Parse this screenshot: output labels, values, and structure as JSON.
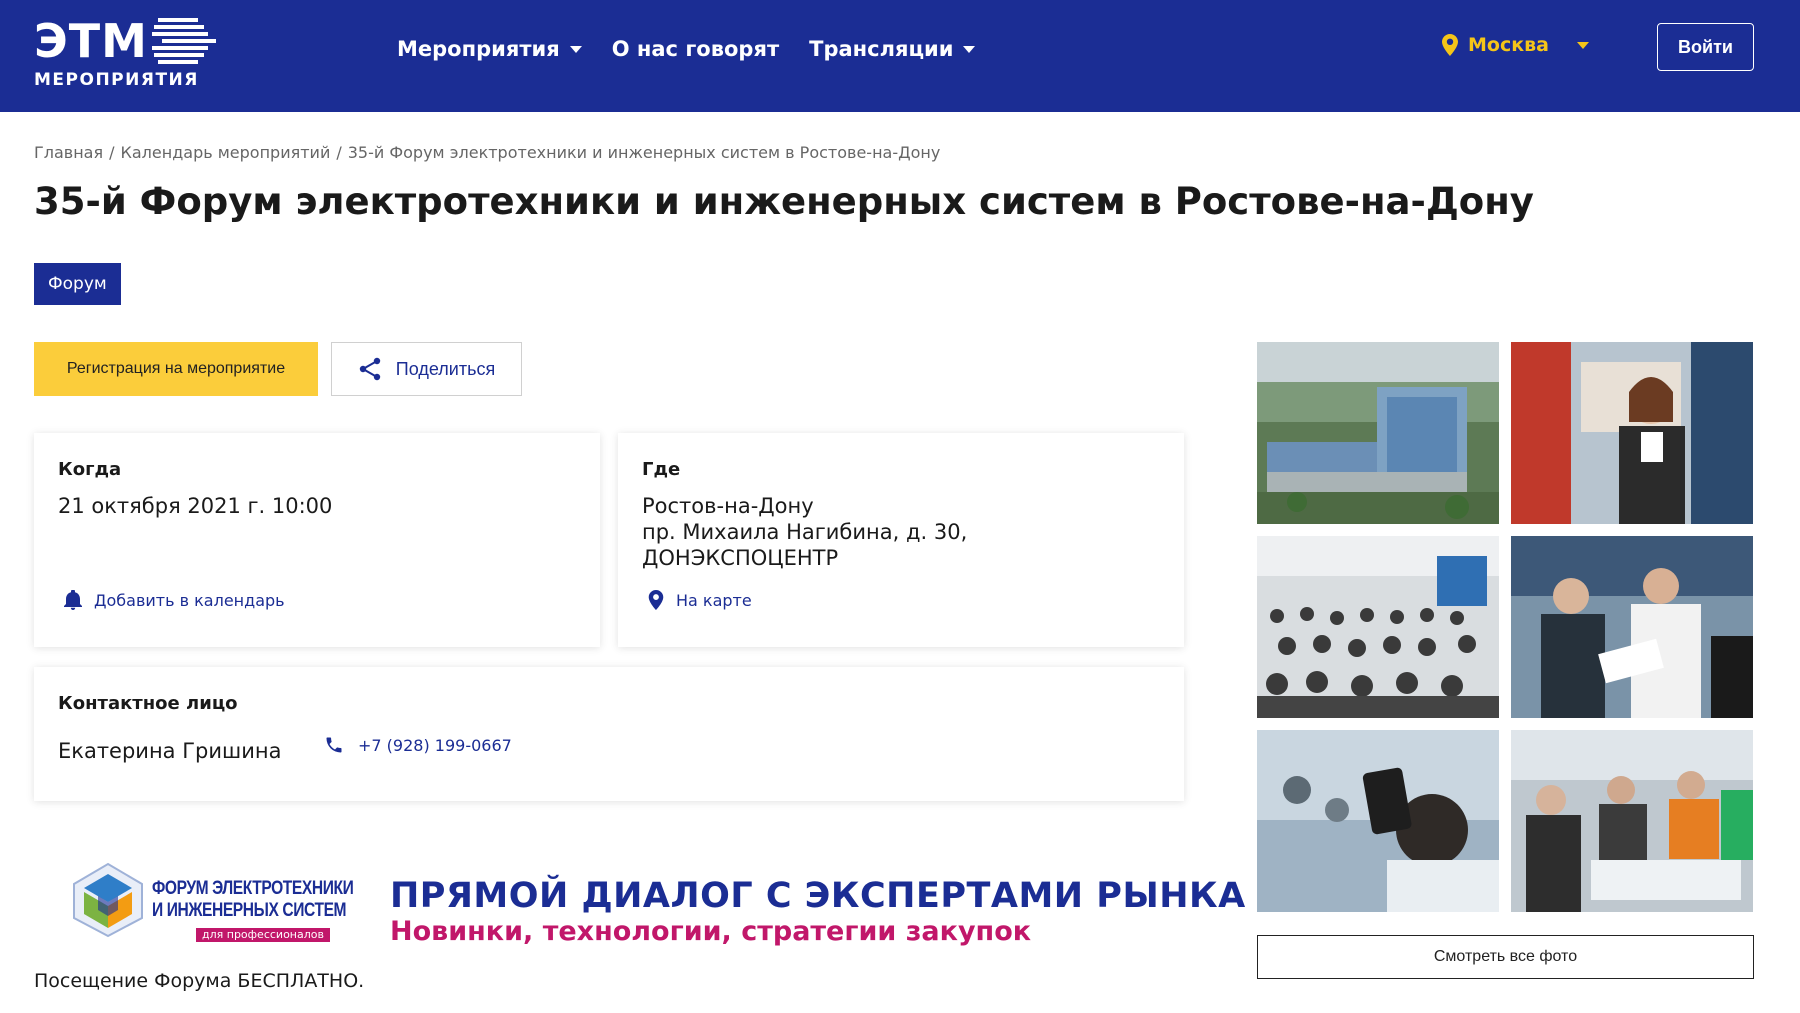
{
  "header": {
    "logo_main": "ЭТМ",
    "logo_sub": "МЕРОПРИЯТИЯ",
    "nav": [
      {
        "label": "Мероприятия"
      },
      {
        "label": "О нас говорят"
      },
      {
        "label": "Трансляции"
      }
    ],
    "city": "Москва",
    "login_label": "Войти",
    "colors": {
      "background": "#1b2d94",
      "city": "#f5c518"
    }
  },
  "breadcrumb": [
    "Главная",
    "Календарь мероприятий",
    "35-й Форум электротехники и инженерных систем в Ростове-на-Дону"
  ],
  "breadcrumb_separator": "/",
  "title": "35-й Форум электротехники и инженерных систем в Ростове-на-Дону",
  "tag": "Форум",
  "actions": {
    "register_label": "Регистрация на мероприятие",
    "share_label": "Поделиться"
  },
  "when": {
    "label": "Когда",
    "value": "21 октября 2021 г. 10:00",
    "link": "Добавить в календарь"
  },
  "where": {
    "label": "Где",
    "lines": [
      "Ростов-на-Дону",
      "пр. Михаила Нагибина, д. 30,",
      "ДОНЭКСПОЦЕНТР"
    ],
    "link": "На карте"
  },
  "contact": {
    "label": "Контактное лицо",
    "name": "Екатерина Гришина",
    "phone": "+7 (928) 199-0667"
  },
  "banner": {
    "logo_lines": [
      "ФОРУМ ЭЛЕКТРОТЕХНИКИ",
      "И ИНЖЕНЕРНЫХ СИСТЕМ"
    ],
    "logo_badge": "для профессионалов",
    "headline": "ПРЯМОЙ ДИАЛОГ С ЭКСПЕРТАМИ РЫНКА",
    "subline": "Новинки, технологии, стратегии закупок"
  },
  "free_note": "Посещение Форума БЕСПЛАТНО.",
  "gallery": {
    "view_all_label": "Смотреть все фото"
  }
}
